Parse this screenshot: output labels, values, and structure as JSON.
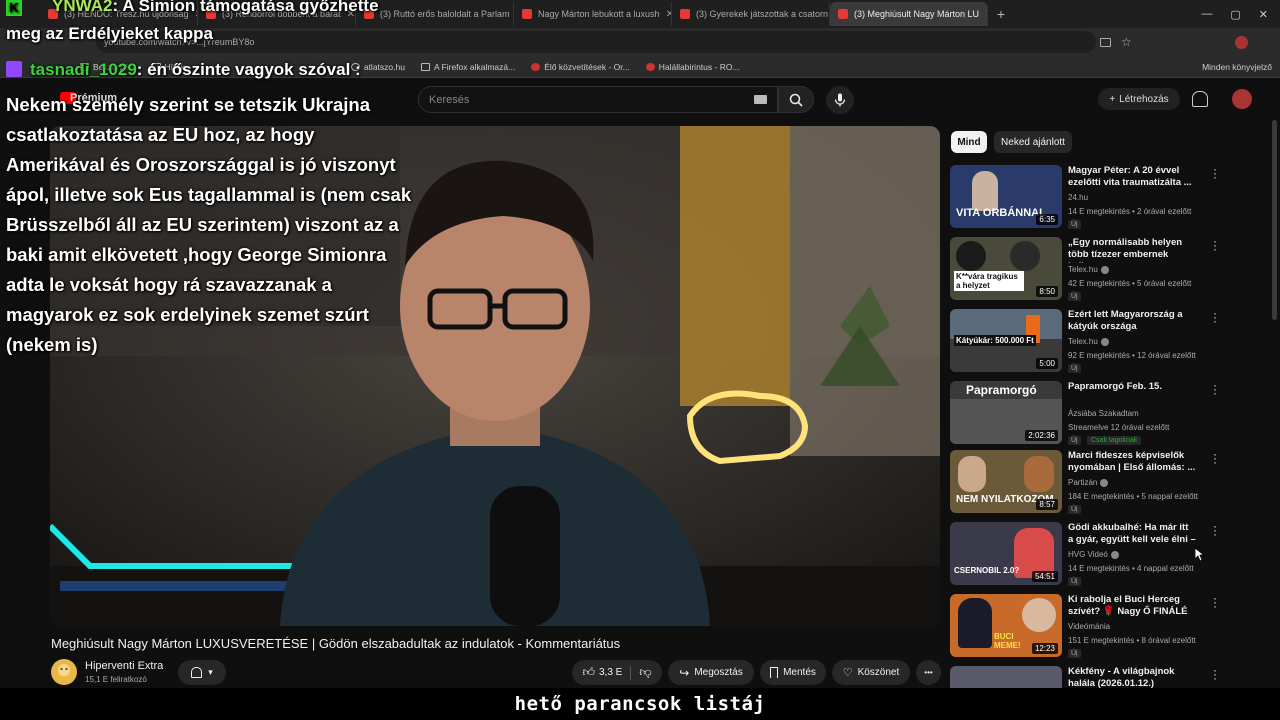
{
  "browser": {
    "tabs": [
      {
        "label": "(3) HENDÓ: Tresz.hu újdonság",
        "color": "#e53935"
      },
      {
        "label": "(3) Rendőrről döbbent a barát",
        "color": "#e53935"
      },
      {
        "label": "(3) Ruttó erős baloldalt a Parlam",
        "color": "#e53935"
      },
      {
        "label": "Nagy Márton lebukott a luxush",
        "color": "#e53935"
      },
      {
        "label": "(3) Gyerekek játszottak a csatorn",
        "color": "#e53935"
      },
      {
        "label": "(3) Meghiúsult Nagy Márton LU",
        "color": "#e53935",
        "active": true
      }
    ],
    "new_tab": "+",
    "url": "youtube.com/watch?v=...jYreumBY8o",
    "bookmarks": [
      "Beszerzé...",
      "Hírek",
      "atlatszo.hu",
      "A Firefox alkalmazá...",
      "Élő közvetítések - Or...",
      "Halállabirintus - RO..."
    ],
    "bookmarks_right": "Minden könyvjelző",
    "window_controls": [
      "—",
      "▢",
      "✕"
    ]
  },
  "youtube": {
    "logo": "Prémium",
    "search_placeholder": "Keresés",
    "create_label": "Létrehozás"
  },
  "stream_overlay": {
    "chat_top_line1_user": "YNWA2",
    "chat_top_line1_text": ": A Simion támogatása győzhette",
    "chat_top_line2": "meg az Erdélyieket kappa",
    "chat_user": "tasnadi_1029",
    "chat_text": ": én őszinte vagyok szóval :",
    "big_text_lines": [
      "Nekem személy szerint se tetszik Ukrajna",
      "csatlakoztatása az EU hoz, az hogy",
      "Amerikával és Oroszországgal is jó viszonyt",
      "ápol, illetve sok Eus tagallammal is (nem csak",
      "Brüsszelből áll az EU szerintem) viszont az a",
      "baki amit elkövetett ,hogy George Simionra",
      "adta le voksát hogy rá szavazzanak a",
      "magyarok ez sok erdelyinek szemet szúrt",
      "(nekem is)"
    ],
    "subtitle": "hető parancsok listáj"
  },
  "video": {
    "title": "Meghiúsult Nagy Márton LUXUSVERETÉSE | Gödön elszabadultak az indulatok - Kommentariátus",
    "channel_name": "Hiperventi Extra",
    "subscribers": "15,1 E feliratkozó",
    "likes": "3,3 E",
    "share_label": "Megosztás",
    "save_label": "Mentés",
    "thanks_label": "Köszönet",
    "more_label": "•••"
  },
  "chips": [
    "Mind",
    "Neked ajánlott"
  ],
  "recommendations": [
    {
      "title": "Magyar Péter: A 20 évvel ezelőtti vita traumatizálta ...",
      "channel": "24.hu",
      "verified": false,
      "meta": "14 E megtekintés • 2 órával ezelőtt",
      "badge": "Új",
      "duration": "6:35",
      "thumb_text": "VITA ORBÁNNAL",
      "bg": "#2a3a6a"
    },
    {
      "title": "„Egy normálisabb helyen több tízezer embernek kellene az ...",
      "channel": "Telex.hu",
      "verified": true,
      "meta": "42 E megtekintés • 5 órával ezelőtt",
      "badge": "Új",
      "duration": "8:50",
      "thumb_text": "K**vára tragikus a helyzet",
      "bg": "#4a4a3a"
    },
    {
      "title": "Ezért lett Magyarország a kátyúk országa",
      "channel": "Telex.hu",
      "verified": true,
      "meta": "92 E megtekintés • 12 órával ezelőtt",
      "badge": "Új",
      "duration": "5:00",
      "thumb_text": "Kátyúkár: 500.000 Ft",
      "bg": "#5a6a7a"
    },
    {
      "title": "Papramorgó Feb. 15.",
      "channel": "Ázsiába Szakadtam",
      "verified": false,
      "meta": "Streamelve 12 órával ezelőtt",
      "badge": "Új",
      "badge2": "Csak tagoknak",
      "duration": "2:02:36",
      "thumb_text": "Papramorgó",
      "bg": "#3a3a3a"
    },
    {
      "title": "Marci fideszes képviselők nyomában | Első állomás: ...",
      "channel": "Partizán",
      "verified": true,
      "meta": "184 E megtekintés • 5 nappal ezelőtt",
      "badge": "Új",
      "duration": "8:57",
      "thumb_text": "NEM NYILATKOZOM",
      "bg": "#6a5a3a"
    },
    {
      "title": "Gödi akkubalhé: Ha már itt a gyár, együtt kell vele élni – ...",
      "channel": "HVG Videó",
      "verified": true,
      "meta": "14 E megtekintés • 4 nappal ezelőtt",
      "badge": "Új",
      "duration": "54:51",
      "thumb_text": "CSERNOBIL 2.0?",
      "bg": "#3a3a4a"
    },
    {
      "title": "Ki rabolja el Buci Herceg szívét? 🌹 Nagy Ő FINÁLÉ",
      "channel": "Videómánia",
      "verified": false,
      "meta": "151 E megtekintés • 8 órával ezelőtt",
      "badge": "Új",
      "duration": "12:23",
      "thumb_text": "BUCI MEME!",
      "bg": "#c86a2a"
    },
    {
      "title": "Kékfény - A világbajnok halála (2026.01.12.)",
      "channel": "",
      "verified": false,
      "meta": "",
      "badge": "",
      "duration": "",
      "thumb_text": "",
      "bg": "#5a5a6a"
    }
  ]
}
